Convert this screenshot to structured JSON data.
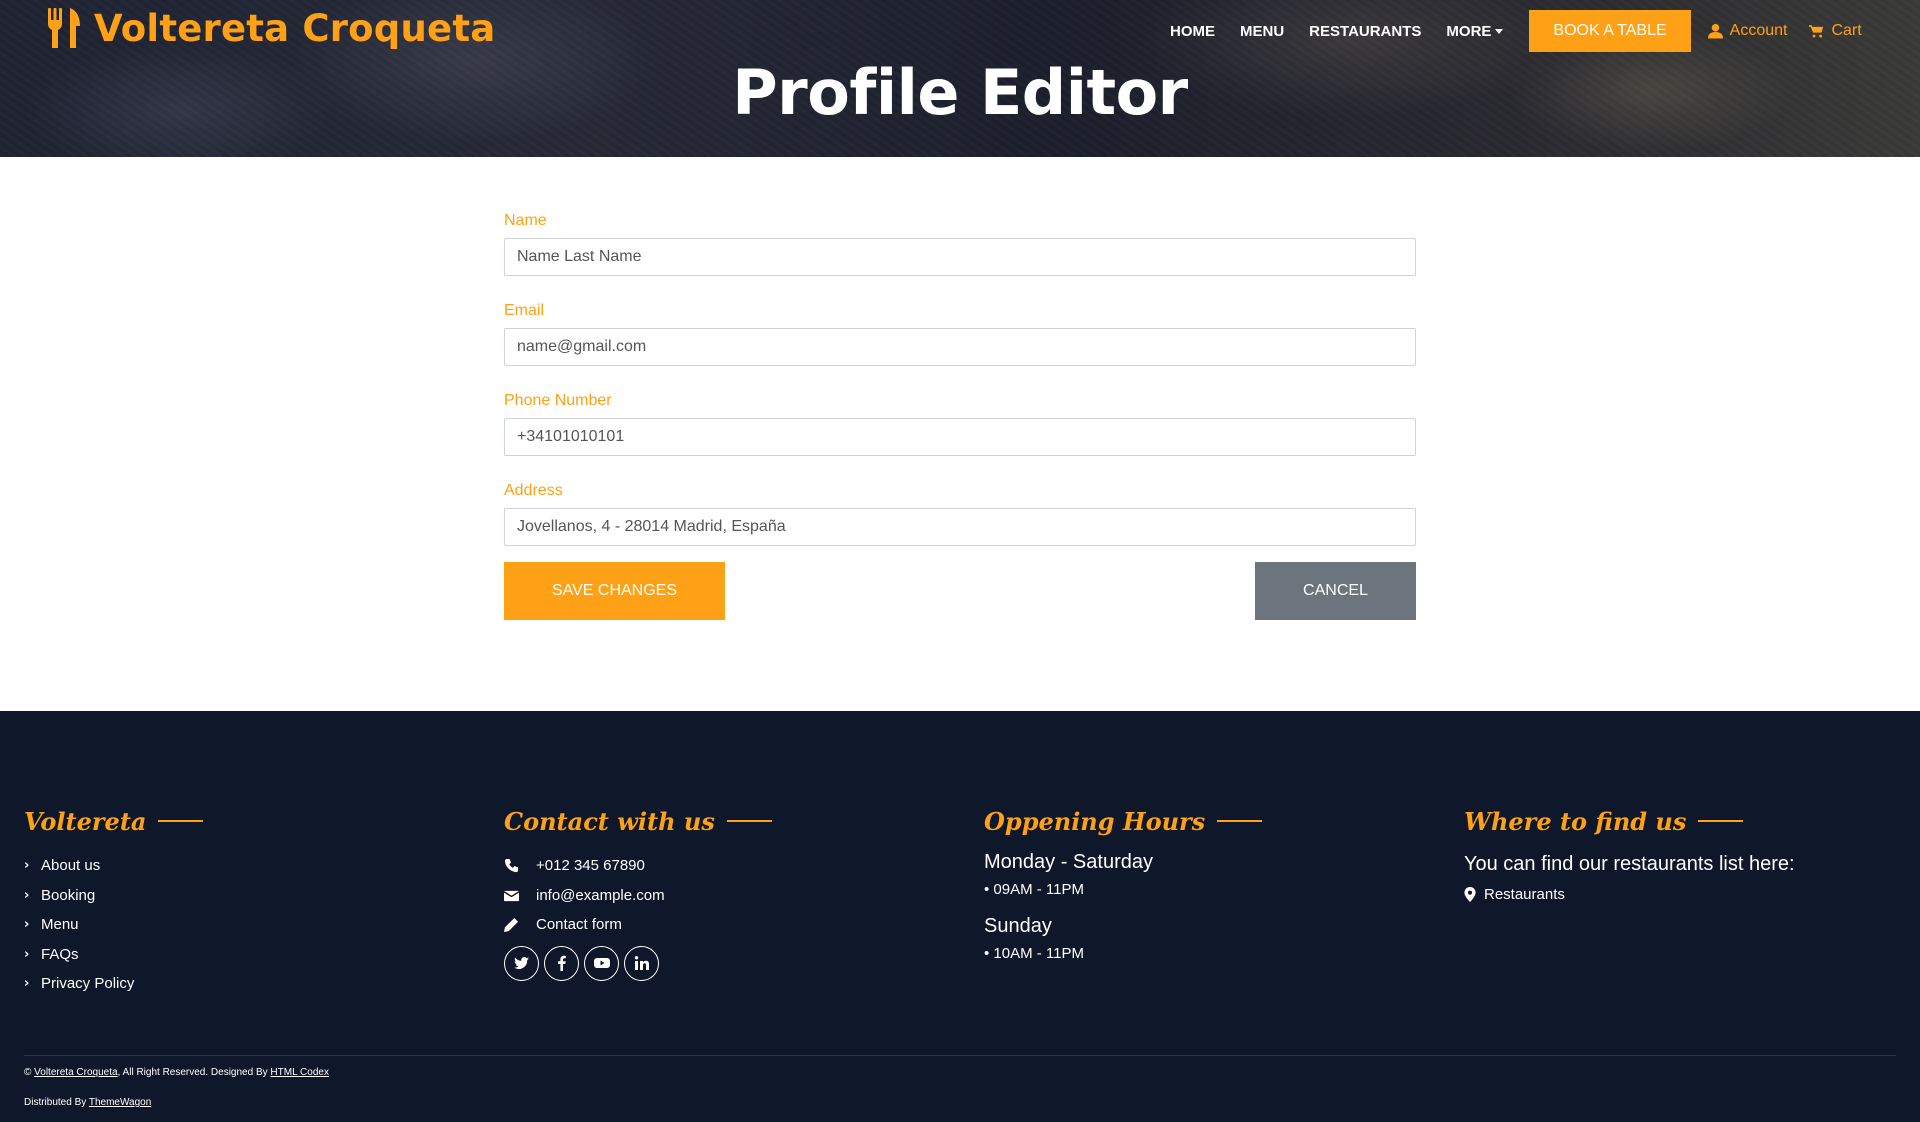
{
  "header": {
    "brand": "Voltereta Croqueta",
    "nav": [
      "HOME",
      "MENU",
      "RESTAURANTS",
      "MORE"
    ],
    "book_button": "BOOK A TABLE",
    "account": "Account",
    "cart": "Cart"
  },
  "page": {
    "title": "Profile Editor"
  },
  "form": {
    "name": {
      "label": "Name",
      "value": "Name Last Name"
    },
    "email": {
      "label": "Email",
      "value": "name@gmail.com"
    },
    "phone": {
      "label": "Phone Number",
      "value": "+34101010101"
    },
    "address": {
      "label": "Address",
      "value": "Jovellanos, 4 - 28014 Madrid, España"
    },
    "save_button": "SAVE CHANGES",
    "cancel_button": "CANCEL"
  },
  "footer": {
    "col1": {
      "title": "Voltereta",
      "links": [
        "About us",
        "Booking",
        "Menu",
        "FAQs",
        "Privacy Policy"
      ]
    },
    "col2": {
      "title": "Contact with us",
      "phone": "+012 345 67890",
      "email": "info@example.com",
      "form": "Contact form",
      "socials": [
        "twitter-icon",
        "facebook-icon",
        "youtube-icon",
        "linkedin-icon"
      ]
    },
    "col3": {
      "title": "Oppening Hours",
      "day1": "Monday - Saturday",
      "hours1": "• 09AM - 11PM",
      "day2": "Sunday",
      "hours2": "• 10AM - 11PM"
    },
    "col4": {
      "title": "Where to find us",
      "text": "You can find our restaurants list here:",
      "link": "Restaurants"
    },
    "copyright": {
      "prefix": "©",
      "brand": "Voltereta Croqueta",
      "middle": ", All Right Reserved. Designed By",
      "designer": "HTML Codex",
      "distributed": "Distributed By",
      "distributor": "ThemeWagon"
    }
  },
  "colors": {
    "accent": "#FEA116",
    "footer_bg": "#0F172B",
    "cancel": "#6c757d"
  }
}
